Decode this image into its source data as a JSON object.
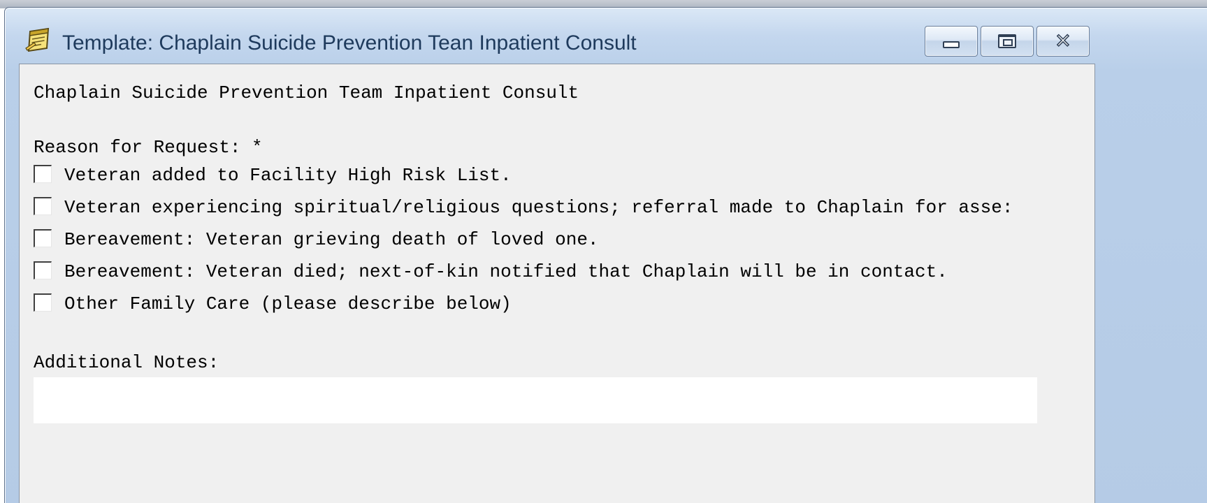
{
  "window": {
    "title": "Template: Chaplain Suicide Prevention Tean Inpatient Consult",
    "icon": "notepad-template-icon",
    "controls": {
      "minimize": "minimize-icon",
      "maximize": "maximize-icon",
      "close": "close-icon"
    }
  },
  "form": {
    "heading": "Chaplain Suicide Prevention Team Inpatient Consult",
    "reason_label": "Reason for Request: *",
    "options": [
      {
        "label": "Veteran added to Facility High Risk List.",
        "checked": false
      },
      {
        "label": "Veteran experiencing spiritual/religious questions; referral made to Chaplain for asse:",
        "checked": false
      },
      {
        "label": "Bereavement: Veteran grieving death of loved one.",
        "checked": false
      },
      {
        "label": "Bereavement: Veteran died; next-of-kin notified that Chaplain will be in contact.",
        "checked": false
      },
      {
        "label": "Other Family Care (please describe below)",
        "checked": false
      }
    ],
    "notes_label": "Additional Notes:",
    "notes_value": ""
  }
}
